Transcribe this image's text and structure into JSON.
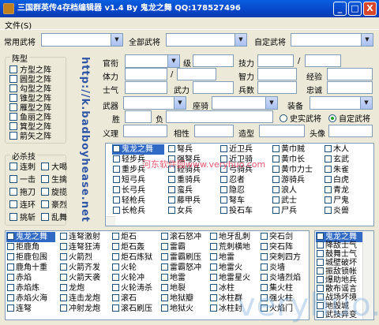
{
  "window": {
    "title": "三国群英传4存档编辑器 v1.4 By 鬼龙之舞 QQ:178527496",
    "minimize": "_",
    "maximize": "□",
    "close": "X"
  },
  "menu": {
    "file": "文件(S)"
  },
  "top_filters": {
    "common_label": "常用武将",
    "all_label": "全部武将",
    "custom_label": "自定武将"
  },
  "stats": {
    "r1": [
      "官衔",
      "级",
      "技力",
      "/"
    ],
    "r2": [
      "体力",
      "/",
      "智力",
      "经验"
    ],
    "r3": [
      "士气",
      "武力",
      "兵数",
      "忠诚"
    ],
    "weapon": "武器",
    "mount": "座骑",
    "equip": "装备",
    "win": "胜",
    "lose": "负",
    "historic": "史实武将",
    "custom": "自定武将",
    "loyalty": "义理",
    "affinity": "相性",
    "build": "造型",
    "portrait": "头像"
  },
  "formation": {
    "title": "阵型",
    "items": [
      "方型之阵",
      "圆型之阵",
      "勾型之阵",
      "锥型之阵",
      "雁型之阵",
      "鱼丽之阵",
      "箕型之阵",
      "箭矢之阵"
    ]
  },
  "skills": {
    "title": "必杀技",
    "items": [
      "连刺",
      "大喝",
      "一击",
      "生擒",
      "拖刀",
      "旋揽",
      "连环",
      "豪烈",
      "挑斩",
      "乱舞"
    ]
  },
  "url_text": "http://k.badboyhease.net",
  "troops": {
    "cols": [
      [
        "鬼龙之舞",
        "轻步兵",
        "重步兵",
        "短弓兵",
        "长弓兵",
        "轻枪兵",
        "长枪兵"
      ],
      [
        "弩兵",
        "强弩兵",
        "轻骑兵",
        "重骑兵",
        "蛮兵",
        "藤甲兵",
        "女兵"
      ],
      [
        "近卫兵",
        "近卫骑",
        "弓骑兵",
        "忍者",
        "隐忍",
        "弩车",
        "投石车"
      ],
      [
        "黄巾贼",
        "黄巾长",
        "黄巾力士",
        "游骑兵",
        "浪人",
        "武士",
        "尸兵"
      ],
      [
        "木人",
        "玄武",
        "朱雀",
        "白虎",
        "青龙",
        "尸鬼",
        "炎兽"
      ]
    ]
  },
  "specials": {
    "cols": [
      [
        "鬼龙之舞",
        "拒鹿角",
        "拒鹿包围",
        "鹿角十重",
        "赤焰",
        "赤焰炼",
        "赤焰火海",
        "连弩"
      ],
      [
        "连弩激射",
        "连弩狂涛",
        "火箭烈",
        "火箭齐发",
        "火箭天袭",
        "龙炮",
        "连击龙炮",
        "冲射龙炮"
      ],
      [
        "炬石",
        "炬石轰",
        "炬石炼狱",
        "火轮",
        "火轮冲",
        "火轮涛杀",
        "滚石",
        "滚石刷压"
      ],
      [
        "滚石怒冲",
        "雷霸",
        "雷霸刷压",
        "雷霸怒冲",
        "地雷",
        "地裂",
        "地狱瓣",
        "地狱火"
      ],
      [
        "地牙乱刺",
        "荒刺横地",
        "地雷",
        "地雷火",
        "地雷星火",
        "冰柱",
        "冰柱群",
        "冰柱封"
      ],
      [
        "突石剑",
        "突石阵",
        "突刺四方",
        "炎墙",
        "炎墙烈焰",
        "集火柱",
        "强火柱",
        "火焰门"
      ]
    ],
    "right": [
      "鬼龙之舞",
      "降敌士气",
      "鼓舞士气",
      "城壁破坏",
      "振敌锁帐",
      "爆助地兵",
      "散布谣言",
      "战场坏境",
      "地毁城",
      "武技异变"
    ]
  },
  "watermarks": {
    "center": "河东软件园www.veryhuo.com",
    "bottom": "veryhuo.com"
  }
}
